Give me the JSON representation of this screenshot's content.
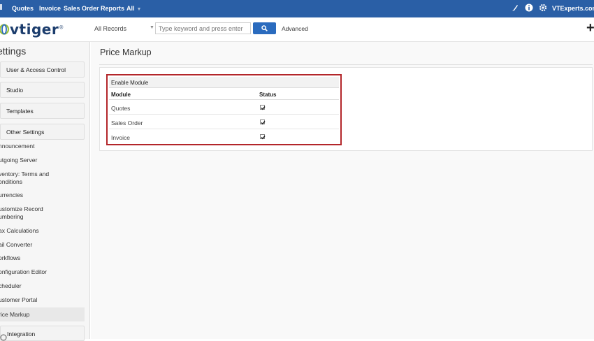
{
  "topbar": {
    "nav": [
      "Quotes",
      "Invoice",
      "Sales Order",
      "Reports",
      "All"
    ],
    "user": "VTExperts.com"
  },
  "header": {
    "logo": "vtiger",
    "search_scope": "All Records",
    "search_placeholder": "Type keyword and press enter",
    "advanced_label": "Advanced"
  },
  "sidebar": {
    "title": "ettings",
    "blocks": [
      "User & Access Control",
      "Studio",
      "Templates",
      "Other Settings"
    ],
    "links": [
      "nnouncement",
      "utgoing Server",
      "ventory: Terms and",
      "onditions",
      "urrencies",
      "ustomize Record",
      "umbering",
      "ax Calculations",
      "ail Converter",
      "orkflows",
      "onfiguration Editor",
      "cheduler",
      "ustomer Portal",
      "rice Markup"
    ],
    "integration": "Integration"
  },
  "main": {
    "title": "Price Markup",
    "table": {
      "header": "Enable Module",
      "columns": [
        "Module",
        "Status"
      ],
      "rows": [
        {
          "module": "Quotes",
          "checked": true
        },
        {
          "module": "Sales Order",
          "checked": true
        },
        {
          "module": "Invoice",
          "checked": true
        }
      ]
    }
  },
  "colors": {
    "topbar": "#2a5fa6",
    "highlight_border": "#b3262a",
    "search_button": "#2a6bbe"
  }
}
